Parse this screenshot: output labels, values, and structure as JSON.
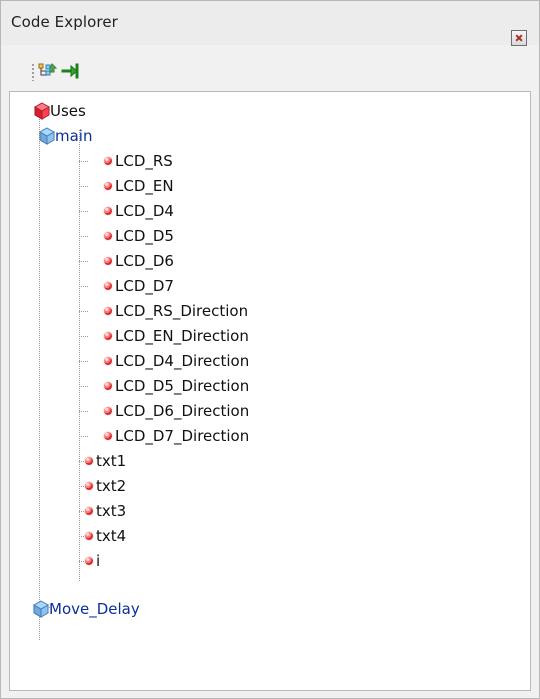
{
  "window": {
    "title": "Code Explorer"
  },
  "toolbar": {
    "buttons": [
      {
        "icon": "tree-outline-icon"
      },
      {
        "icon": "go-to-icon"
      }
    ]
  },
  "tree": {
    "uses": "Uses",
    "main": "main",
    "children": [
      "LCD_RS",
      "LCD_EN",
      "LCD_D4",
      "LCD_D5",
      "LCD_D6",
      "LCD_D7",
      "LCD_RS_Direction",
      "LCD_EN_Direction",
      "LCD_D4_Direction",
      "LCD_D5_Direction",
      "LCD_D6_Direction",
      "LCD_D7_Direction",
      "txt1",
      "txt2",
      "txt3",
      "txt4",
      "i"
    ],
    "move_delay": "Move_Delay"
  },
  "colors": {
    "panel_bg": "#f1f1f1",
    "tree_bg": "#ffffff",
    "border": "#b9b9b9",
    "label_blue": "#0a2f9a",
    "label_black": "#111111",
    "dot_red": "#d92c2c"
  }
}
